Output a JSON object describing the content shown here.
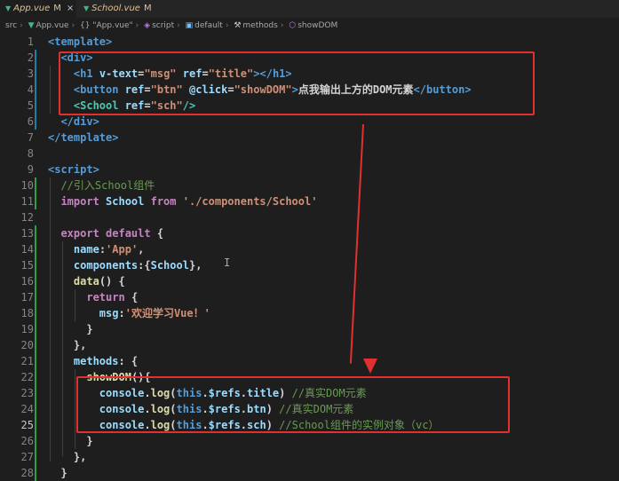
{
  "tabs": [
    {
      "label": "App.vue",
      "badge": "M",
      "active": true
    },
    {
      "label": "School.vue",
      "badge": "M",
      "active": false
    }
  ],
  "breadcrumb": [
    "src",
    "App.vue",
    "{} \"App.vue\"",
    "script",
    "default",
    "methods",
    "showDOM"
  ],
  "lines": [
    {
      "n": "1",
      "segs": [
        [
          "tag",
          "<template>"
        ]
      ]
    },
    {
      "n": "2",
      "segs": [
        [
          "txtc",
          "  "
        ],
        [
          "tag",
          "<div>"
        ]
      ]
    },
    {
      "n": "3",
      "segs": [
        [
          "txtc",
          "    "
        ],
        [
          "tag",
          "<h1 "
        ],
        [
          "attr",
          "v-text"
        ],
        [
          "txtc",
          "="
        ],
        [
          "str",
          "\"msg\""
        ],
        [
          "txtc",
          " "
        ],
        [
          "attr",
          "ref"
        ],
        [
          "txtc",
          "="
        ],
        [
          "str",
          "\"title\""
        ],
        [
          "tag",
          "></h1>"
        ]
      ]
    },
    {
      "n": "4",
      "segs": [
        [
          "txtc",
          "    "
        ],
        [
          "tag",
          "<button "
        ],
        [
          "attr",
          "ref"
        ],
        [
          "txtc",
          "="
        ],
        [
          "str",
          "\"btn\""
        ],
        [
          "txtc",
          " "
        ],
        [
          "attr",
          "@click"
        ],
        [
          "txtc",
          "="
        ],
        [
          "str",
          "\"showDOM\""
        ],
        [
          "tag",
          ">"
        ],
        [
          "txtc",
          "点我输出上方的DOM元素"
        ],
        [
          "tag",
          "</button>"
        ]
      ]
    },
    {
      "n": "5",
      "segs": [
        [
          "txtc",
          "    "
        ],
        [
          "cmp",
          "<School "
        ],
        [
          "attr",
          "ref"
        ],
        [
          "txtc",
          "="
        ],
        [
          "str",
          "\"sch\""
        ],
        [
          "cmp",
          "/>"
        ]
      ]
    },
    {
      "n": "6",
      "segs": [
        [
          "txtc",
          "  "
        ],
        [
          "tag",
          "</div>"
        ]
      ]
    },
    {
      "n": "7",
      "segs": [
        [
          "tag",
          "</template>"
        ]
      ]
    },
    {
      "n": "8",
      "segs": []
    },
    {
      "n": "9",
      "segs": [
        [
          "tag",
          "<script>"
        ]
      ]
    },
    {
      "n": "10",
      "segs": [
        [
          "com",
          "  //引入School组件"
        ]
      ]
    },
    {
      "n": "11",
      "segs": [
        [
          "txtc",
          "  "
        ],
        [
          "k",
          "import "
        ],
        [
          "attr",
          "School "
        ],
        [
          "k",
          "from "
        ],
        [
          "str",
          "'./components/School'"
        ]
      ]
    },
    {
      "n": "12",
      "segs": []
    },
    {
      "n": "13",
      "segs": [
        [
          "txtc",
          "  "
        ],
        [
          "k",
          "export default "
        ],
        [
          "txtc",
          "{"
        ]
      ]
    },
    {
      "n": "14",
      "segs": [
        [
          "txtc",
          "    "
        ],
        [
          "attr",
          "name"
        ],
        [
          "txtc",
          ":"
        ],
        [
          "str",
          "'App'"
        ],
        [
          "txtc",
          ","
        ]
      ]
    },
    {
      "n": "15",
      "segs": [
        [
          "txtc",
          "    "
        ],
        [
          "attr",
          "components"
        ],
        [
          "txtc",
          ":{"
        ],
        [
          "attr",
          "School"
        ],
        [
          "txtc",
          "},"
        ]
      ]
    },
    {
      "n": "16",
      "segs": [
        [
          "txtc",
          "    "
        ],
        [
          "fn",
          "data"
        ],
        [
          "txtc",
          "() {"
        ]
      ]
    },
    {
      "n": "17",
      "segs": [
        [
          "txtc",
          "      "
        ],
        [
          "k",
          "return "
        ],
        [
          "txtc",
          "{"
        ]
      ]
    },
    {
      "n": "18",
      "segs": [
        [
          "txtc",
          "        "
        ],
        [
          "attr",
          "msg"
        ],
        [
          "txtc",
          ":"
        ],
        [
          "str",
          "'欢迎学习Vue！'"
        ]
      ]
    },
    {
      "n": "19",
      "segs": [
        [
          "txtc",
          "      }"
        ]
      ]
    },
    {
      "n": "20",
      "segs": [
        [
          "txtc",
          "    },"
        ]
      ]
    },
    {
      "n": "21",
      "segs": [
        [
          "txtc",
          "    "
        ],
        [
          "attr",
          "methods"
        ],
        [
          "txtc",
          ": {"
        ]
      ]
    },
    {
      "n": "22",
      "segs": [
        [
          "txtc",
          "      "
        ],
        [
          "fn",
          "showDOM"
        ],
        [
          "txtc",
          "(){"
        ]
      ]
    },
    {
      "n": "23",
      "segs": [
        [
          "txtc",
          "        "
        ],
        [
          "attr",
          "console"
        ],
        [
          "txtc",
          "."
        ],
        [
          "fn",
          "log"
        ],
        [
          "txtc",
          "("
        ],
        [
          "kw2",
          "this"
        ],
        [
          "txtc",
          "."
        ],
        [
          "attr",
          "$refs"
        ],
        [
          "txtc",
          "."
        ],
        [
          "attr",
          "title"
        ],
        [
          "txtc",
          ") "
        ],
        [
          "com",
          "//真实DOM元素"
        ]
      ]
    },
    {
      "n": "24",
      "segs": [
        [
          "txtc",
          "        "
        ],
        [
          "attr",
          "console"
        ],
        [
          "txtc",
          "."
        ],
        [
          "fn",
          "log"
        ],
        [
          "txtc",
          "("
        ],
        [
          "kw2",
          "this"
        ],
        [
          "txtc",
          "."
        ],
        [
          "attr",
          "$refs"
        ],
        [
          "txtc",
          "."
        ],
        [
          "attr",
          "btn"
        ],
        [
          "txtc",
          ") "
        ],
        [
          "com",
          "//真实DOM元素"
        ]
      ]
    },
    {
      "n": "25",
      "segs": [
        [
          "txtc",
          "        "
        ],
        [
          "attr",
          "console"
        ],
        [
          "txtc",
          "."
        ],
        [
          "fn",
          "log"
        ],
        [
          "txtc",
          "("
        ],
        [
          "kw2",
          "this"
        ],
        [
          "txtc",
          "."
        ],
        [
          "attr",
          "$refs"
        ],
        [
          "txtc",
          "."
        ],
        [
          "attr",
          "sch"
        ],
        [
          "txtc",
          ") "
        ],
        [
          "com",
          "//School组件的实例对象（vc）"
        ]
      ]
    },
    {
      "n": "26",
      "segs": [
        [
          "txtc",
          "      }"
        ]
      ]
    },
    {
      "n": "27",
      "segs": [
        [
          "txtc",
          "    },"
        ]
      ]
    },
    {
      "n": "28",
      "segs": [
        [
          "txtc",
          "  }"
        ]
      ]
    }
  ],
  "current_line": "25",
  "colors": {
    "highlight_box": "#e03030",
    "keyword": "#c586c0",
    "tag": "#569cd6",
    "string": "#ce9178",
    "comment": "#6a9955"
  }
}
